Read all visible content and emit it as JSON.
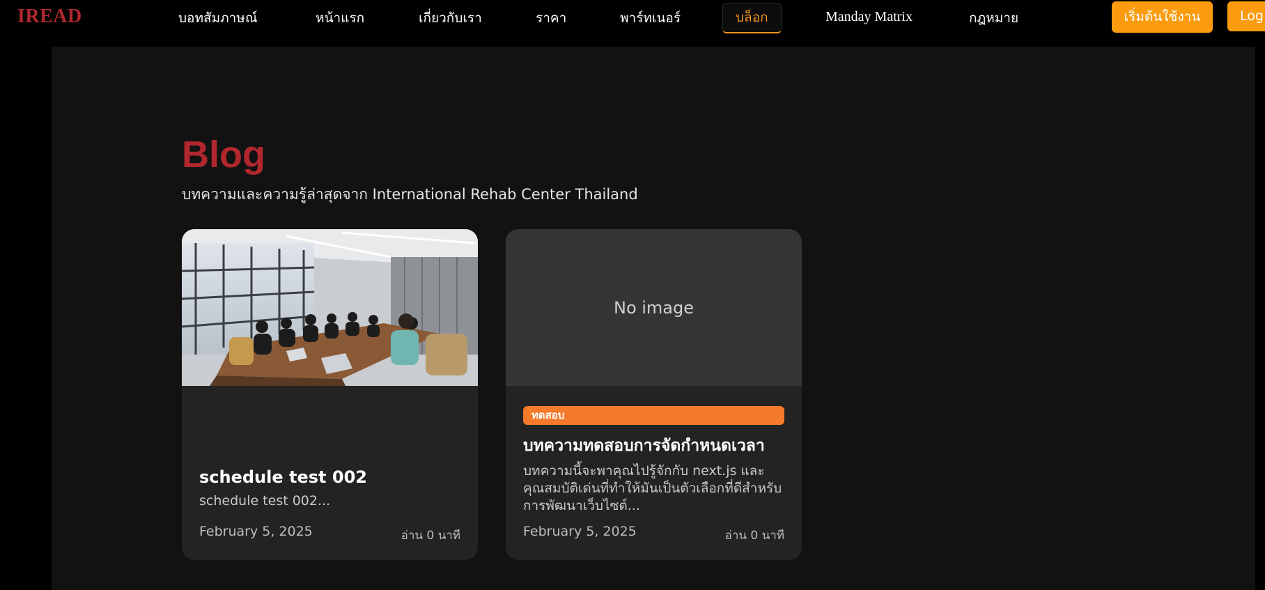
{
  "brand": {
    "logo_text": "IREAD",
    "logo_color": "#b0282e"
  },
  "nav": {
    "items": [
      {
        "label": "บอทสัมภาษณ์"
      },
      {
        "label": "หน้าแรก"
      },
      {
        "label": "เกี่ยวกับเรา"
      },
      {
        "label": "ราคา"
      },
      {
        "label": "พาร์ทเนอร์"
      },
      {
        "label": "บล็อก",
        "active": true
      },
      {
        "label": "Manday Matrix"
      },
      {
        "label": "กฎหมาย"
      }
    ],
    "cta_start": "เริ่มต้นใช้งาน",
    "cta_login": "Log",
    "accent_color": "#fb9b0e"
  },
  "page": {
    "title": "Blog",
    "subtitle": "บทความและความรู้ล่าสุดจาก International Rehab Center Thailand"
  },
  "posts": [
    {
      "image": "meeting-room-photo",
      "title": "schedule test 002",
      "excerpt": "schedule test 002...",
      "date": "February 5, 2025",
      "read_time": "อ่าน 0 นาที"
    },
    {
      "image_placeholder": "No image",
      "tag": "ทดสอบ",
      "title": "บทความทดสอบการจัดกำหนดเวลา",
      "excerpt": "บทความนี้จะพาคุณไปรู้จักกับ next.js และคุณสมบัติเด่นที่ทำให้มันเป็นตัวเลือกที่ดีสำหรับการพัฒนาเว็บไซต์...",
      "date": "February 5, 2025",
      "read_time": "อ่าน 0 นาที"
    }
  ]
}
